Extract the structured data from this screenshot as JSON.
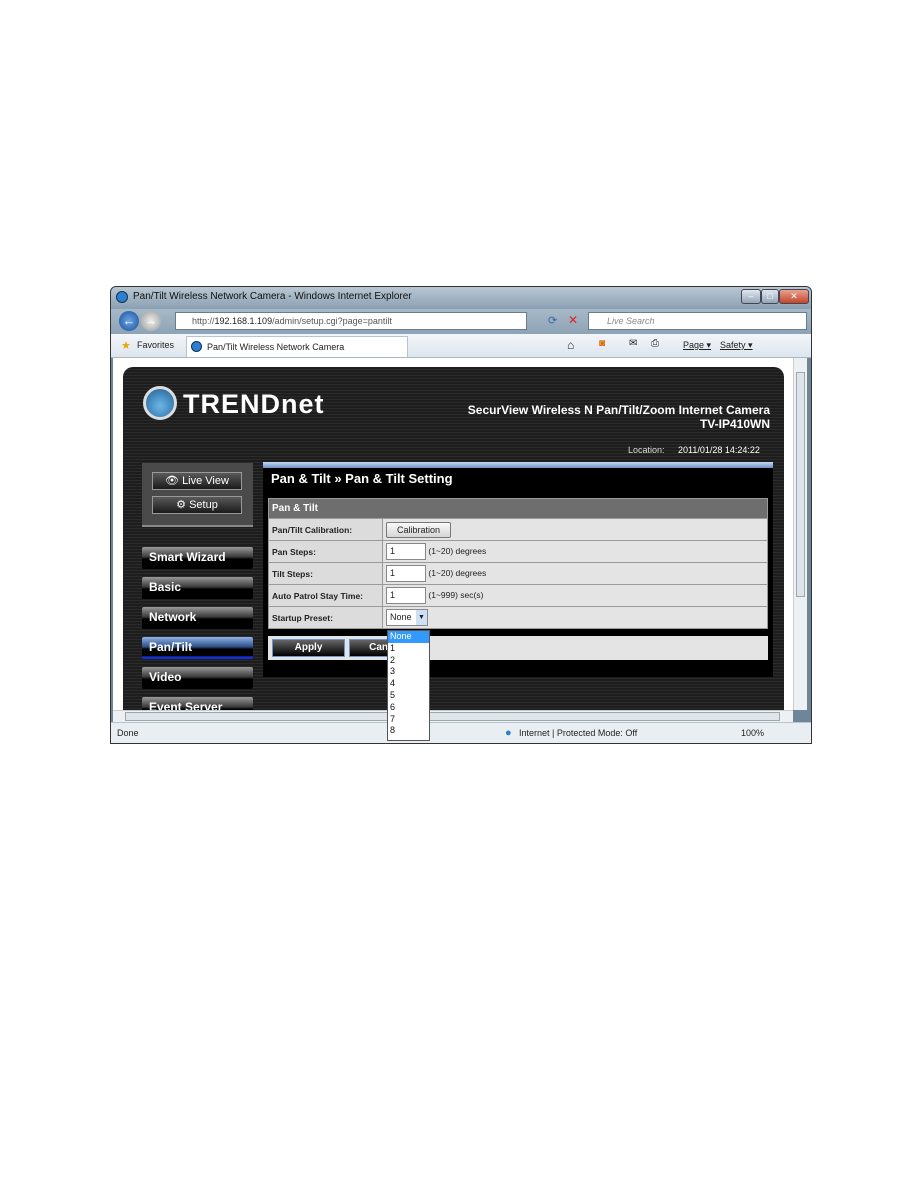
{
  "browser": {
    "title": "Pan/Tilt Wireless Network Camera - Windows Internet Explorer",
    "url_prefix": "http://",
    "url_host": "192.168.1.109",
    "url_path": "/admin/setup.cgi?page=pantilt",
    "search_placeholder": "Live Search",
    "favorites": "Favorites",
    "tab": "Pan/Tilt Wireless Network Camera",
    "page_menu": "Page ▾",
    "safety_menu": "Safety ▾",
    "status": "Done",
    "zone": "Internet | Protected Mode: Off",
    "zoom": "100%"
  },
  "camera": {
    "brand": "TRENDnet",
    "product": "SecurView Wireless N Pan/Tilt/Zoom Internet Camera",
    "model": "TV-IP410WN",
    "location_label": "Location:",
    "datetime": "2011/01/28 14:24:22",
    "live_view": "Live View",
    "setup": "Setup",
    "menu": [
      "Smart Wizard",
      "Basic",
      "Network",
      "Pan/Tilt",
      "Video",
      "Event Server"
    ],
    "active_menu": "Pan/Tilt",
    "page_title": "Pan & Tilt » Pan & Tilt Setting",
    "section": "Pan & Tilt",
    "rows": {
      "calibration_label": "Pan/Tilt Calibration:",
      "calibration_button": "Calibration",
      "pan_label": "Pan Steps:",
      "pan_value": "1",
      "pan_hint": "(1~20) degrees",
      "tilt_label": "Tilt Steps:",
      "tilt_value": "1",
      "tilt_hint": "(1~20) degrees",
      "patrol_label": "Auto Patrol Stay Time:",
      "patrol_value": "1",
      "patrol_hint": "(1~999) sec(s)",
      "preset_label": "Startup Preset:",
      "preset_value": "None"
    },
    "preset_options": [
      "None",
      "1",
      "2",
      "3",
      "4",
      "5",
      "6",
      "7",
      "8"
    ],
    "apply": "Apply",
    "cancel": "Cancel"
  }
}
